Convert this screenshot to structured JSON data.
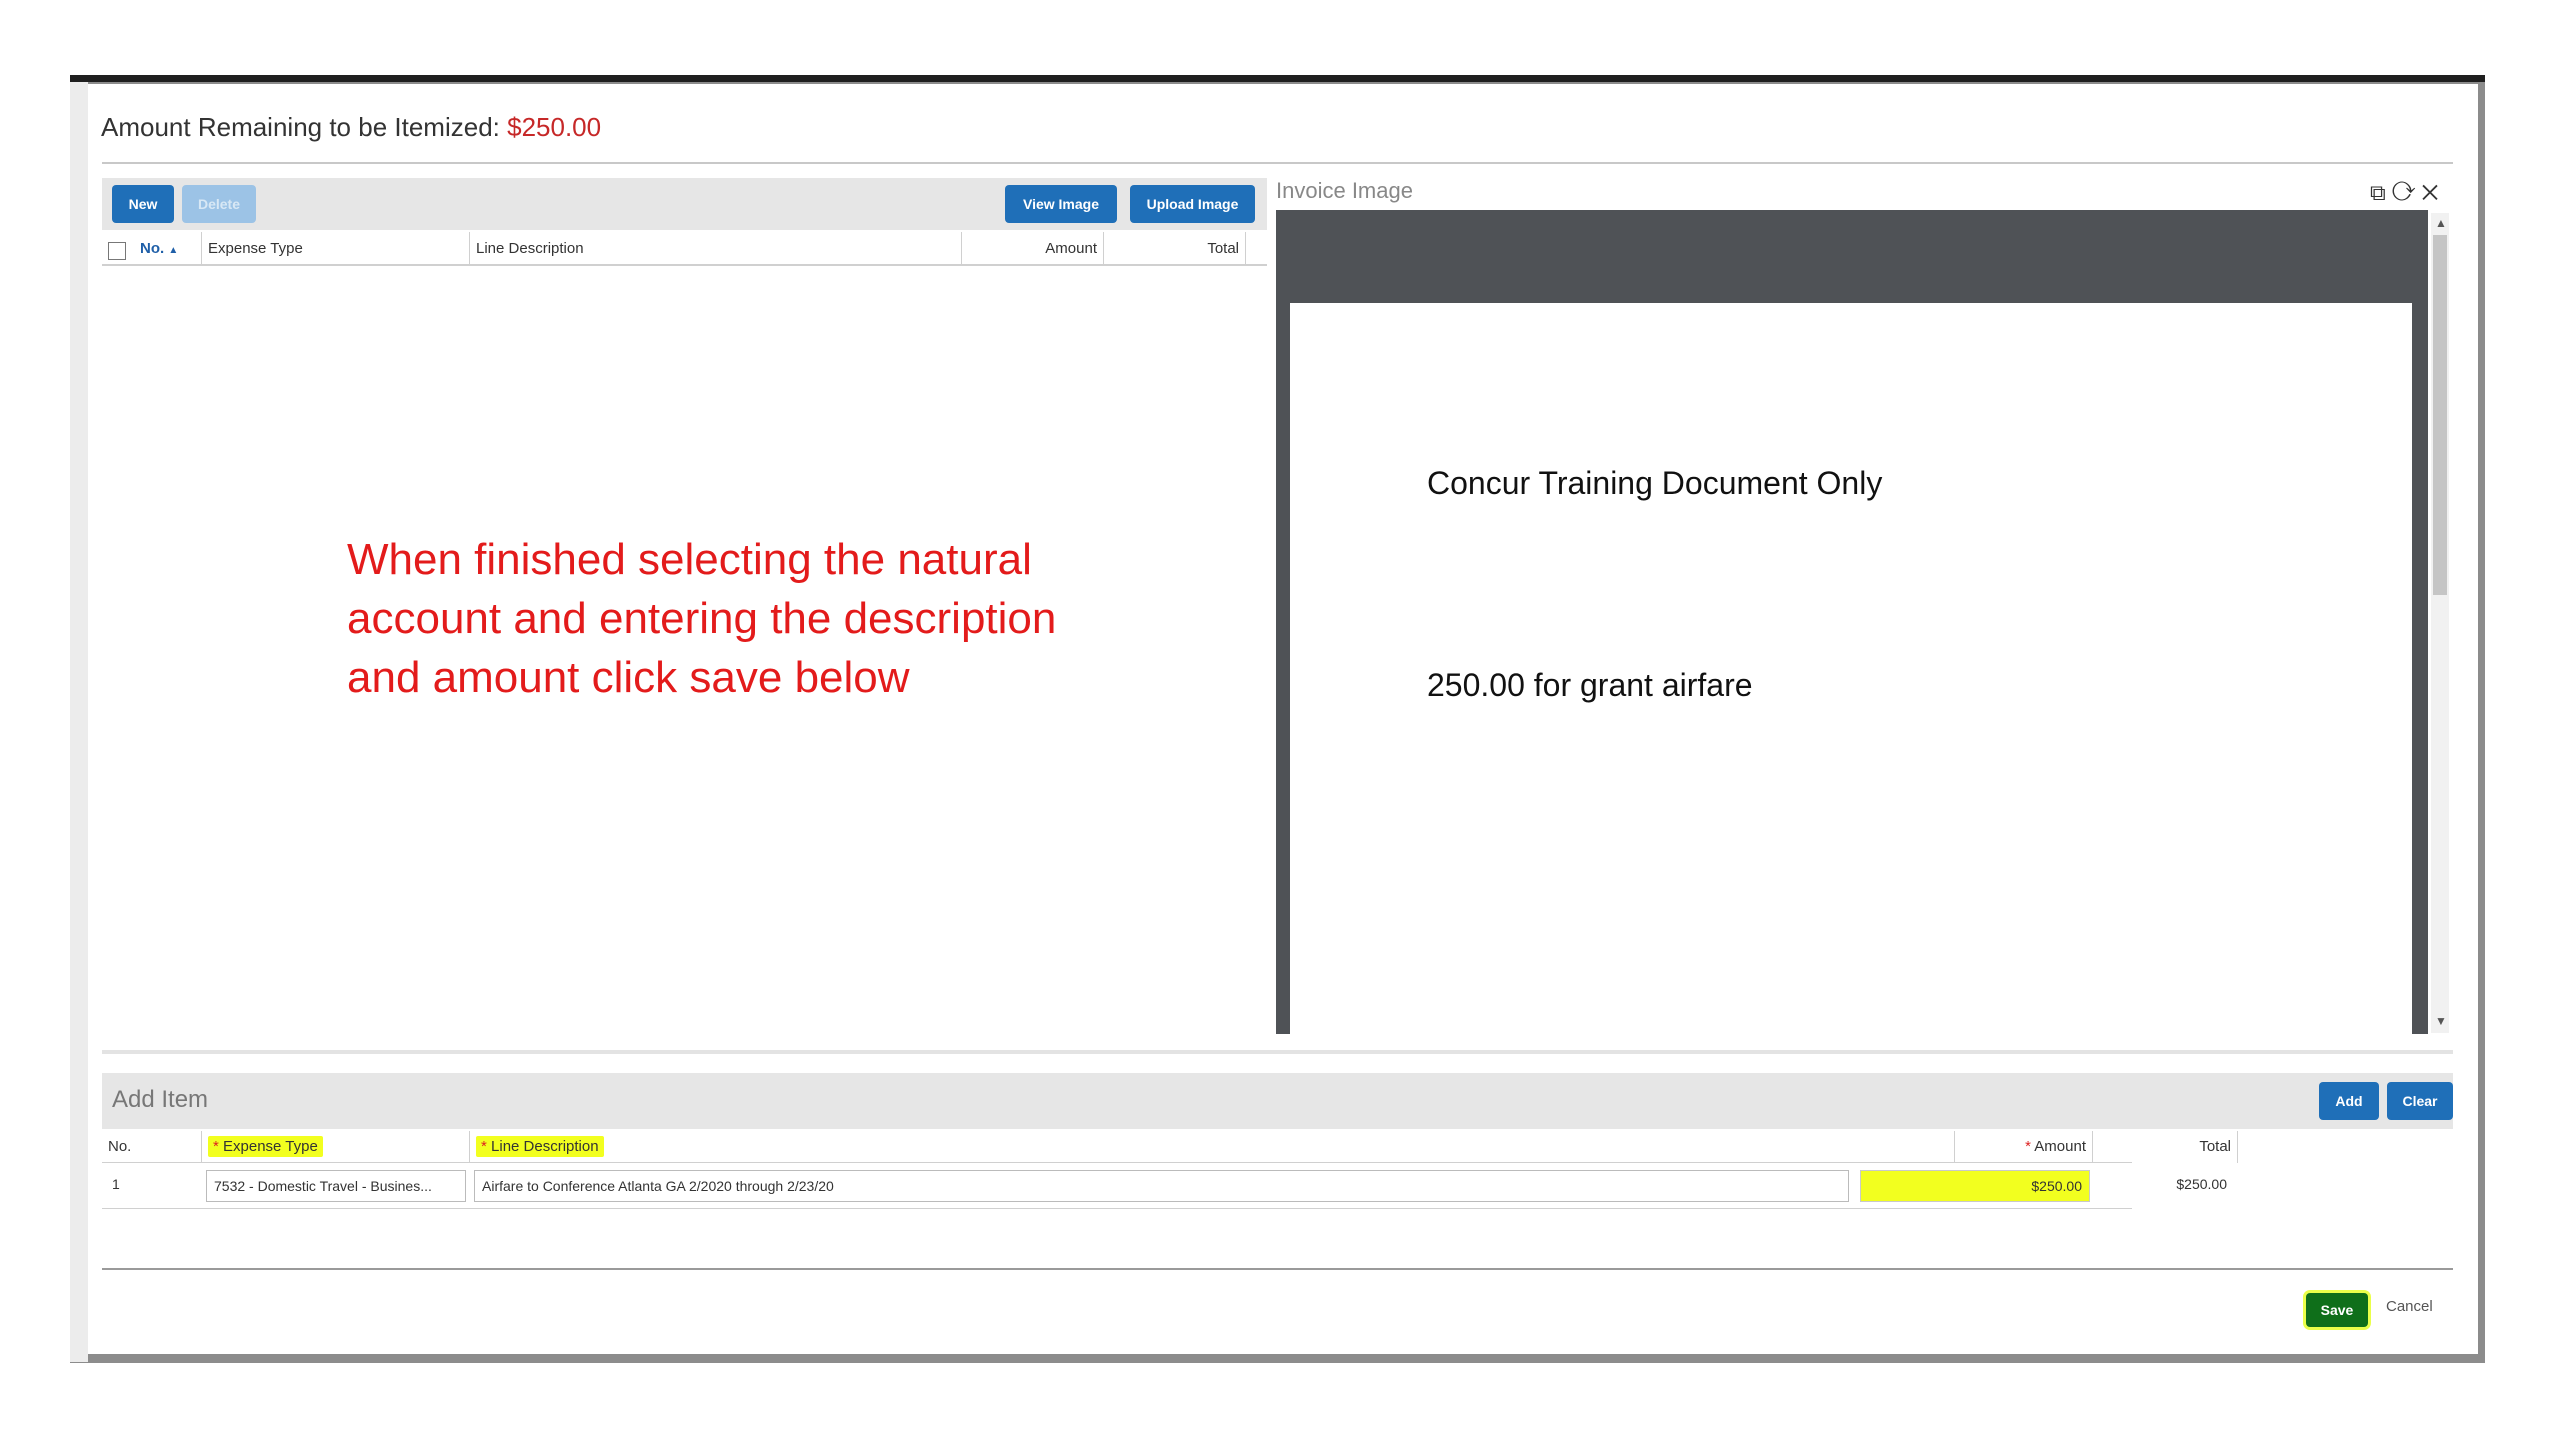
{
  "header": {
    "amount_label": "Amount Remaining to be Itemized:",
    "amount_value": "$250.00"
  },
  "itemization": {
    "buttons": {
      "new": "New",
      "delete": "Delete",
      "view_image": "View Image",
      "upload_image": "Upload Image"
    },
    "columns": [
      "No.",
      "Expense Type",
      "Line Description",
      "Amount",
      "Total"
    ],
    "sort_indicator": "▲"
  },
  "instruction": "When finished selecting the natural account and entering the description and amount click save below",
  "invoice": {
    "title": "Invoice Image",
    "controls": [
      "maximize-icon",
      "refresh-icon",
      "close-icon"
    ],
    "doc_lines": [
      "Concur Training Document Only",
      "250.00 for grant airfare"
    ]
  },
  "add_item": {
    "title": "Add Item",
    "buttons": {
      "add": "Add",
      "clear": "Clear"
    },
    "columns": {
      "no": "No.",
      "expense_type": "Expense Type",
      "line_description": "Line Description",
      "amount": "Amount",
      "total": "Total"
    },
    "required_mark": "*",
    "row": {
      "no": "1",
      "expense_type": "7532 - Domestic Travel - Busines...",
      "line_description": "Airfare to Conference Atlanta GA 2/2020 through 2/23/20",
      "amount": "$250.00",
      "total": "$250.00"
    }
  },
  "footer": {
    "save": "Save",
    "cancel": "Cancel"
  },
  "colors": {
    "accent": "#1f6fb8",
    "amount_red": "#c62828",
    "instruction_red": "#e31b1b",
    "highlight": "#f2ff1f",
    "save_green": "#0f6f1a"
  }
}
